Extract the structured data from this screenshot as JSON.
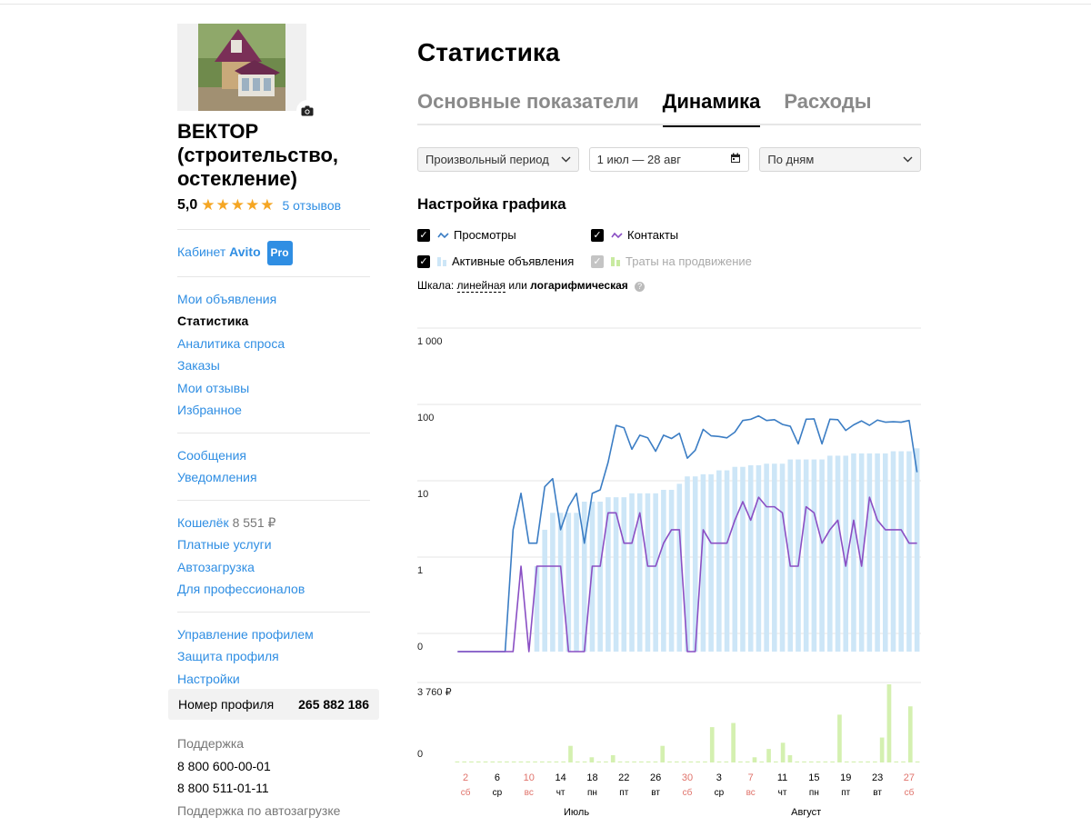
{
  "sidebar": {
    "company_name": "ВЕКТОР (строительство, остекление)",
    "rating": "5,0",
    "reviews": "5 отзывов",
    "cabinet_label": "Кабинет",
    "avito_word": "Avito",
    "pro_badge": "Pro",
    "nav1": [
      "Мои объявления",
      "Статистика",
      "Аналитика спроса",
      "Заказы",
      "Мои отзывы",
      "Избранное"
    ],
    "nav2": [
      "Сообщения",
      "Уведомления"
    ],
    "wallet_label": "Кошелёк",
    "wallet_amount": "8 551 ₽",
    "nav3": [
      "Платные услуги",
      "Автозагрузка",
      "Для профессионалов"
    ],
    "nav4": [
      "Управление профилем",
      "Защита профиля",
      "Настройки"
    ],
    "profile_number_label": "Номер профиля",
    "profile_number": "265 882 186",
    "support_label": "Поддержка",
    "phone1": "8 800 600-00-01",
    "phone2": "8 800 511-01-11",
    "support_autoload": "Поддержка по автозагрузке"
  },
  "main": {
    "title": "Статистика",
    "tabs": [
      "Основные показатели",
      "Динамика",
      "Расходы"
    ],
    "active_tab": "Динамика",
    "period_select": "Произвольный период",
    "date_range": "1 июл — 28 авг",
    "group_select": "По дням",
    "settings_title": "Настройка графика",
    "legend": {
      "views": "Просмотры",
      "contacts": "Контакты",
      "active_ads": "Активные объявления",
      "promo_spend": "Траты на продвижение"
    },
    "scale_prefix": "Шкала:",
    "scale_linear": "линейная",
    "scale_or": "или",
    "scale_log": "логарифмическая"
  },
  "colors": {
    "accent": "#2f8ee3",
    "views_line": "#3b7dc4",
    "contacts_line": "#8a4fc4",
    "active_bars": "#cde6f7",
    "spend_bars": "#d4f0b0",
    "weekend": "#e0736b"
  },
  "chart_data": {
    "type": "line",
    "scale": "log",
    "y_ticks": [
      "1 000",
      "100",
      "10",
      "1",
      "0"
    ],
    "y_tick_values": [
      1000,
      100,
      10,
      1,
      0
    ],
    "spend_y_ticks": [
      "3 760 ₽",
      "0"
    ],
    "spend_max": 3760,
    "x_labels": [
      {
        "day": "2",
        "dow": "сб",
        "weekend": true,
        "index": 1
      },
      {
        "day": "6",
        "dow": "ср",
        "weekend": false,
        "index": 5
      },
      {
        "day": "10",
        "dow": "вс",
        "weekend": true,
        "index": 9
      },
      {
        "day": "14",
        "dow": "чт",
        "weekend": false,
        "index": 13
      },
      {
        "day": "18",
        "dow": "пн",
        "weekend": false,
        "index": 17
      },
      {
        "day": "22",
        "dow": "пт",
        "weekend": false,
        "index": 21
      },
      {
        "day": "26",
        "dow": "вт",
        "weekend": false,
        "index": 25
      },
      {
        "day": "30",
        "dow": "сб",
        "weekend": true,
        "index": 29
      },
      {
        "day": "3",
        "dow": "ср",
        "weekend": false,
        "index": 33
      },
      {
        "day": "7",
        "dow": "вс",
        "weekend": true,
        "index": 37
      },
      {
        "day": "11",
        "dow": "чт",
        "weekend": false,
        "index": 41
      },
      {
        "day": "15",
        "dow": "пн",
        "weekend": false,
        "index": 45
      },
      {
        "day": "19",
        "dow": "пт",
        "weekend": false,
        "index": 49
      },
      {
        "day": "23",
        "dow": "вт",
        "weekend": false,
        "index": 53
      },
      {
        "day": "27",
        "dow": "сб",
        "weekend": true,
        "index": 57
      }
    ],
    "months": [
      {
        "label": "Июль",
        "index": 15
      },
      {
        "label": "Август",
        "index": 44
      }
    ],
    "days_count": 59,
    "series": [
      {
        "name": "Просмотры",
        "values": [
          0,
          0,
          0,
          0,
          0,
          0,
          0,
          3,
          9,
          2,
          2,
          11,
          14,
          3,
          6,
          9,
          2,
          9,
          10,
          23,
          70,
          65,
          34,
          52,
          48,
          32,
          52,
          47,
          55,
          26,
          33,
          62,
          51,
          50,
          48,
          57,
          81,
          84,
          93,
          81,
          83,
          72,
          68,
          40,
          84,
          85,
          40,
          84,
          83,
          60,
          71,
          80,
          70,
          82,
          77,
          78,
          77,
          81,
          17
        ],
        "color": "#3b7dc4"
      },
      {
        "name": "Контакты",
        "values": [
          0,
          0,
          0,
          0,
          0,
          0,
          0,
          0,
          1,
          0,
          1,
          1,
          1,
          1,
          0,
          0,
          0,
          1,
          1,
          5,
          5,
          2,
          2,
          5,
          1,
          1,
          2,
          3,
          3,
          0,
          0,
          3,
          2,
          2,
          2,
          4,
          7,
          4,
          8,
          6,
          6,
          5,
          1,
          1,
          6,
          5,
          2,
          3,
          4,
          1,
          4,
          1,
          8,
          4,
          3,
          3,
          3,
          2,
          2
        ],
        "color": "#8a4fc4"
      },
      {
        "name": "Активные объявления",
        "values": [
          0,
          0,
          0,
          0,
          0,
          0,
          0,
          0,
          0,
          0,
          1,
          3,
          5,
          5,
          5,
          5,
          7,
          7,
          7,
          8,
          8,
          8,
          9,
          9,
          9,
          9,
          10,
          10,
          12,
          15,
          15,
          16,
          16,
          18,
          18,
          20,
          20,
          21,
          21,
          22,
          22,
          22,
          25,
          25,
          25,
          25,
          25,
          28,
          28,
          28,
          30,
          30,
          30,
          30,
          30,
          32,
          32,
          32,
          35
        ],
        "color": "#cde6f7"
      },
      {
        "name": "Траты на продвижение",
        "values": [
          0,
          0,
          0,
          0,
          0,
          0,
          0,
          0,
          0,
          0,
          0,
          0,
          0,
          0,
          0,
          0,
          0,
          0,
          0,
          0,
          0,
          0,
          0,
          0,
          0,
          0,
          0,
          0,
          0,
          0,
          0,
          0,
          0,
          0,
          0,
          0,
          0,
          0,
          0,
          0,
          0,
          0,
          0,
          0,
          0,
          0,
          0,
          0,
          0,
          0,
          0,
          0,
          0,
          0,
          0,
          0,
          0,
          0,
          0
        ],
        "color": "#d4f0b0"
      }
    ],
    "spend_values": [
      50,
      50,
      50,
      50,
      50,
      50,
      50,
      50,
      50,
      50,
      50,
      50,
      50,
      50,
      50,
      50,
      800,
      50,
      50,
      250,
      50,
      50,
      350,
      50,
      50,
      50,
      50,
      50,
      50,
      800,
      50,
      50,
      50,
      50,
      50,
      50,
      1700,
      50,
      50,
      1900,
      50,
      50,
      250,
      50,
      650,
      50,
      950,
      350,
      50,
      50,
      50,
      50,
      50,
      50,
      2300,
      50,
      50,
      50,
      50,
      50,
      1200,
      3760,
      50,
      50,
      2700,
      50
    ],
    "spend_days": 59
  }
}
